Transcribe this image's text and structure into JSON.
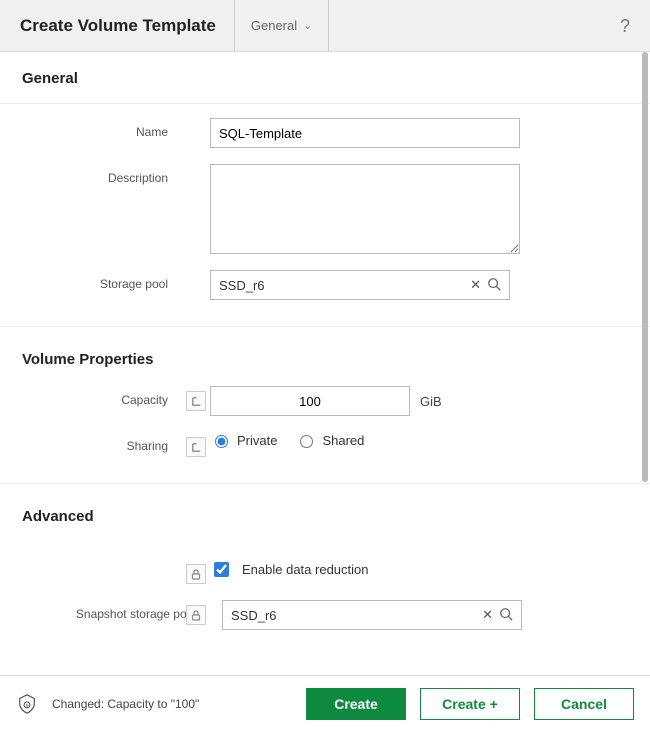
{
  "header": {
    "title": "Create Volume Template",
    "tab_label": "General"
  },
  "sections": {
    "general": {
      "title": "General",
      "name_label": "Name",
      "name_value": "SQL-Template",
      "description_label": "Description",
      "description_value": "",
      "pool_label": "Storage pool",
      "pool_value": "SSD_r6"
    },
    "volume": {
      "title": "Volume Properties",
      "capacity_label": "Capacity",
      "capacity_value": "100",
      "capacity_unit": "GiB",
      "sharing_label": "Sharing",
      "sharing_private": "Private",
      "sharing_shared": "Shared"
    },
    "advanced": {
      "title": "Advanced",
      "data_reduction_label": "Enable data reduction",
      "snap_pool_label": "Snapshot storage pool",
      "snap_pool_value": "SSD_r6"
    }
  },
  "footer": {
    "status": "Changed: Capacity to \"100\"",
    "create": "Create",
    "create_plus": "Create +",
    "cancel": "Cancel"
  }
}
